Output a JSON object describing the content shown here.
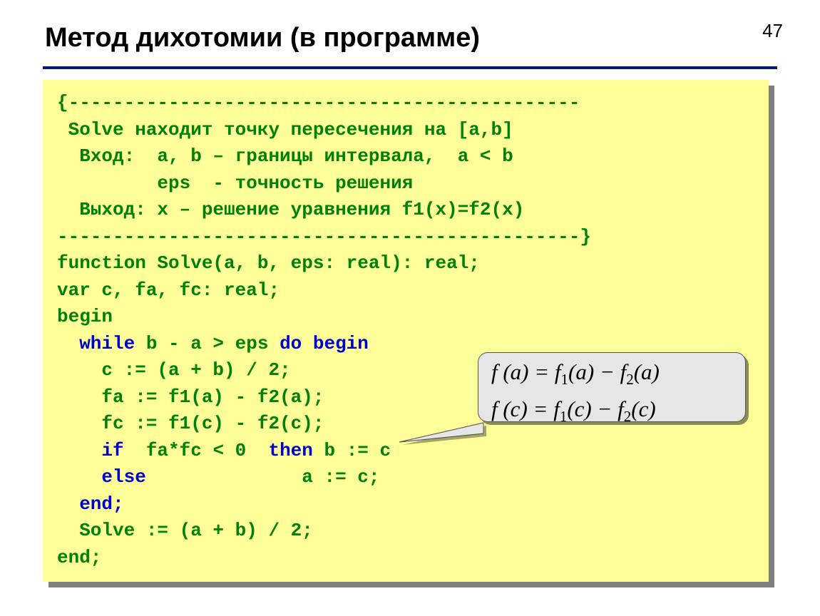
{
  "page_number": "47",
  "title": "Метод дихотомии (в программе)",
  "code": {
    "comment_open": "{----------------------------------------------",
    "comment_l1": " Solve находит точку пересечения на [a,b]",
    "comment_l2": "  Вход:  a, b – границы интервала,  a < b",
    "comment_l3": "         eps  - точность решения",
    "comment_l4": "  Выход: x – решение уравнения f1(x)=f2(x)",
    "comment_close": "-----------------------------------------------}",
    "decl1": "function Solve(a, b, eps: real): real;",
    "decl2": "var c, fa, fc: real;",
    "begin": "begin",
    "while_kw": "  while",
    "while_cond": " b - a > eps ",
    "do_begin": "do begin",
    "body1": "    c := (a + b) / 2;",
    "body2": "    fa := f1(a) - f2(a);",
    "body3": "    fc := f1(c) - f2(c);",
    "if_kw": "    if",
    "if_cond": "  fa*fc < 0  ",
    "then_kw": "then",
    "then_body": " b := c",
    "else_kw": "    else",
    "else_body": "              a := c;",
    "end1": "  end;",
    "solve_assign": "  Solve := (a + b) / 2;",
    "end2": "end;"
  },
  "callout": {
    "line1_a": "f (a) = f",
    "line1_s1": "1",
    "line1_b": "(a) − f",
    "line1_s2": "2",
    "line1_c": "(a)",
    "line2_a": "f (c) = f",
    "line2_s1": "1",
    "line2_b": "(c) − f",
    "line2_s2": "2",
    "line2_c": "(c)"
  }
}
